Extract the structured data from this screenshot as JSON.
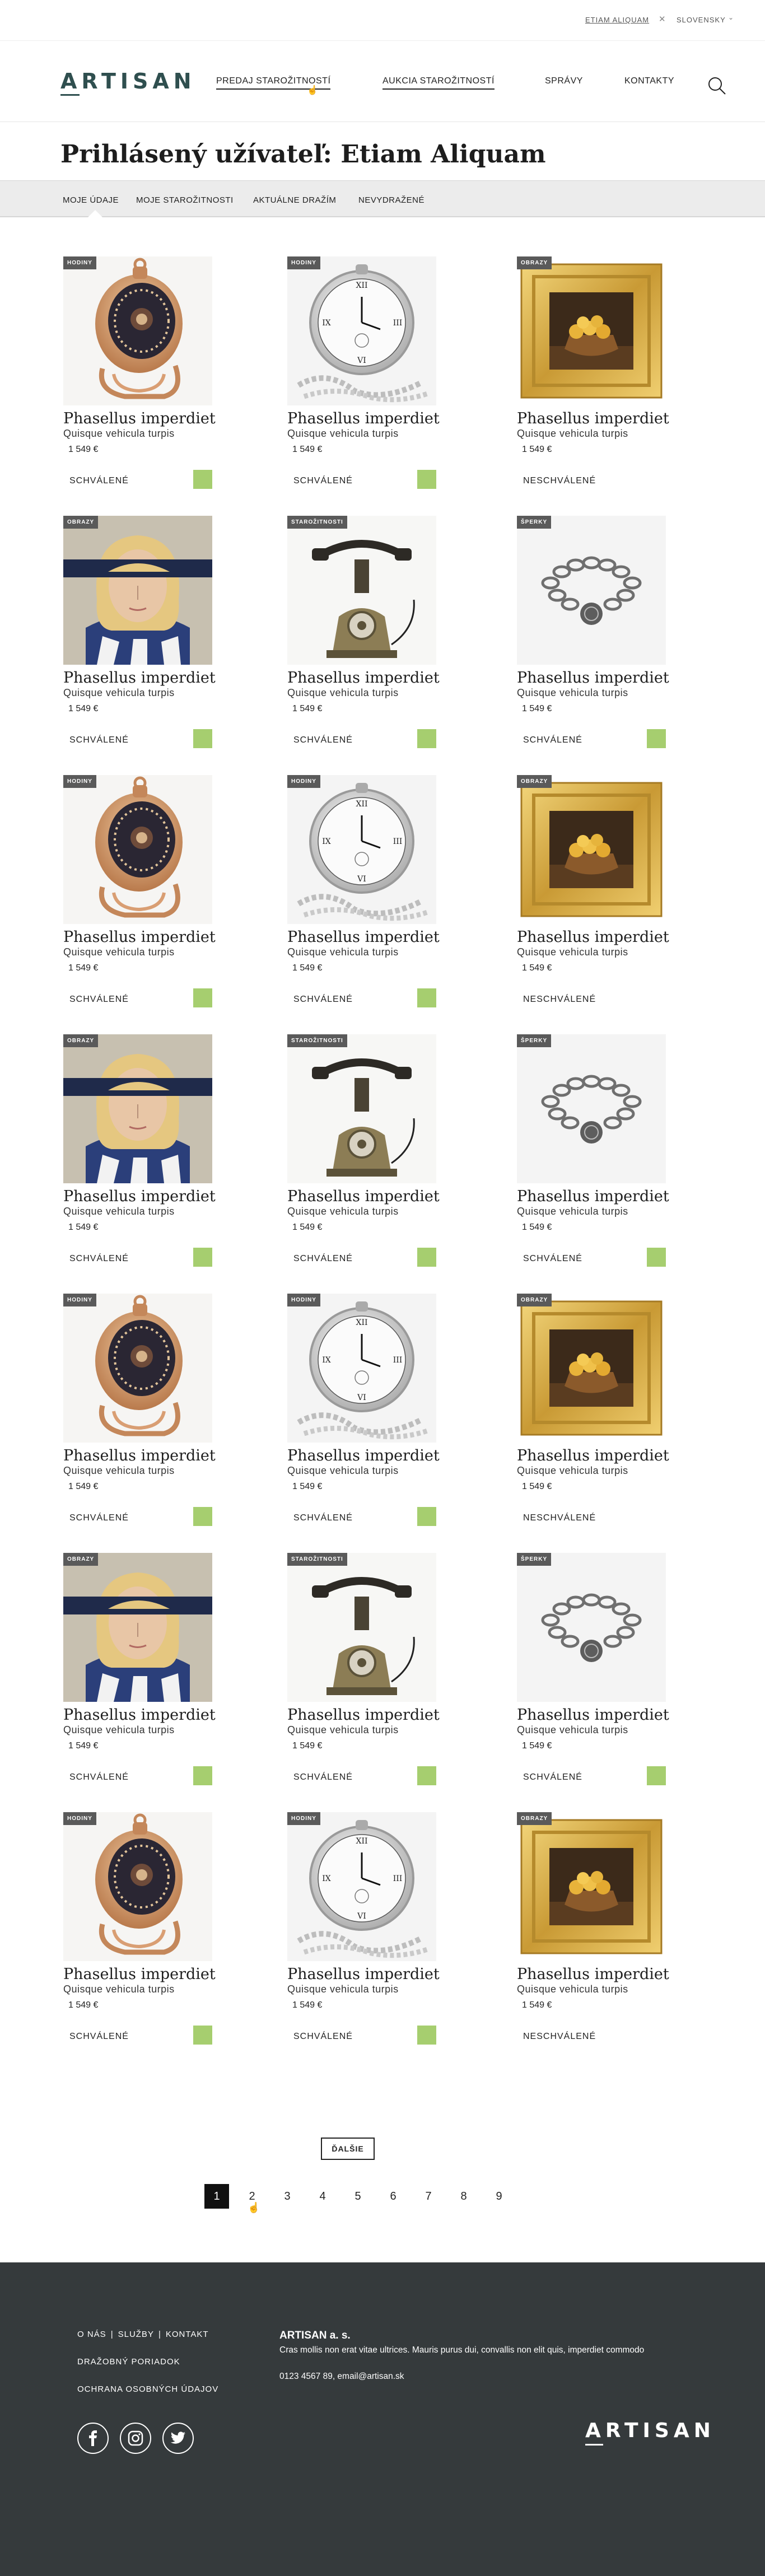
{
  "topbar": {
    "user": "ETIAM ALIQUAM",
    "language": "SLOVENSKY"
  },
  "header": {
    "logo": "ARTISAN",
    "nav": [
      "PREDAJ STAROŽITNOSTÍ",
      "AUKCIA STAROŽITNOSTÍ",
      "SPRÁVY",
      "KONTAKTY"
    ]
  },
  "page": {
    "title": "Prihlásený užívateľ: Etiam Aliquam"
  },
  "tabs": [
    "MOJE ÚDAJE",
    "MOJE STAROŽITNOSTI",
    "AKTUÁLNE DRAŽÍM",
    "NEVYDRAŽENÉ"
  ],
  "items": [
    {
      "category": "HODINY",
      "name": "Phasellus imperdiet",
      "desc": "Quisque vehicula turpis",
      "price": "1 549 €",
      "status": "SCHVÁLENÉ",
      "approved": true,
      "image": "pocket-watch-gold"
    },
    {
      "category": "HODINY",
      "name": "Phasellus imperdiet",
      "desc": "Quisque vehicula turpis",
      "price": "1 549 €",
      "status": "SCHVÁLENÉ",
      "approved": true,
      "image": "pocket-watch-silver"
    },
    {
      "category": "OBRAZY",
      "name": "Phasellus imperdiet",
      "desc": "Quisque vehicula turpis",
      "price": "1 549 €",
      "status": "NESCHVÁLENÉ",
      "approved": false,
      "image": "framed-painting"
    },
    {
      "category": "OBRAZY",
      "name": "Phasellus imperdiet",
      "desc": "Quisque vehicula turpis",
      "price": "1 549 €",
      "status": "SCHVÁLENÉ",
      "approved": true,
      "image": "portrait-painting"
    },
    {
      "category": "STAROŽITNOSTI",
      "name": "Phasellus imperdiet",
      "desc": "Quisque vehicula turpis",
      "price": "1 549 €",
      "status": "SCHVÁLENÉ",
      "approved": true,
      "image": "antique-phone"
    },
    {
      "category": "ŠPERKY",
      "name": "Phasellus imperdiet",
      "desc": "Quisque vehicula turpis",
      "price": "1 549 €",
      "status": "SCHVÁLENÉ",
      "approved": true,
      "image": "silver-bracelet"
    },
    {
      "category": "HODINY",
      "name": "Phasellus imperdiet",
      "desc": "Quisque vehicula turpis",
      "price": "1 549 €",
      "status": "SCHVÁLENÉ",
      "approved": true,
      "image": "pocket-watch-gold"
    },
    {
      "category": "HODINY",
      "name": "Phasellus imperdiet",
      "desc": "Quisque vehicula turpis",
      "price": "1 549 €",
      "status": "SCHVÁLENÉ",
      "approved": true,
      "image": "pocket-watch-silver"
    },
    {
      "category": "OBRAZY",
      "name": "Phasellus imperdiet",
      "desc": "Quisque vehicula turpis",
      "price": "1 549 €",
      "status": "NESCHVÁLENÉ",
      "approved": false,
      "image": "framed-painting"
    },
    {
      "category": "OBRAZY",
      "name": "Phasellus imperdiet",
      "desc": "Quisque vehicula turpis",
      "price": "1 549 €",
      "status": "SCHVÁLENÉ",
      "approved": true,
      "image": "portrait-painting"
    },
    {
      "category": "STAROŽITNOSTI",
      "name": "Phasellus imperdiet",
      "desc": "Quisque vehicula turpis",
      "price": "1 549 €",
      "status": "SCHVÁLENÉ",
      "approved": true,
      "image": "antique-phone"
    },
    {
      "category": "ŠPERKY",
      "name": "Phasellus imperdiet",
      "desc": "Quisque vehicula turpis",
      "price": "1 549 €",
      "status": "SCHVÁLENÉ",
      "approved": true,
      "image": "silver-bracelet"
    },
    {
      "category": "HODINY",
      "name": "Phasellus imperdiet",
      "desc": "Quisque vehicula turpis",
      "price": "1 549 €",
      "status": "SCHVÁLENÉ",
      "approved": true,
      "image": "pocket-watch-gold"
    },
    {
      "category": "HODINY",
      "name": "Phasellus imperdiet",
      "desc": "Quisque vehicula turpis",
      "price": "1 549 €",
      "status": "SCHVÁLENÉ",
      "approved": true,
      "image": "pocket-watch-silver"
    },
    {
      "category": "OBRAZY",
      "name": "Phasellus imperdiet",
      "desc": "Quisque vehicula turpis",
      "price": "1 549 €",
      "status": "NESCHVÁLENÉ",
      "approved": false,
      "image": "framed-painting"
    },
    {
      "category": "OBRAZY",
      "name": "Phasellus imperdiet",
      "desc": "Quisque vehicula turpis",
      "price": "1 549 €",
      "status": "SCHVÁLENÉ",
      "approved": true,
      "image": "portrait-painting"
    },
    {
      "category": "STAROŽITNOSTI",
      "name": "Phasellus imperdiet",
      "desc": "Quisque vehicula turpis",
      "price": "1 549 €",
      "status": "SCHVÁLENÉ",
      "approved": true,
      "image": "antique-phone"
    },
    {
      "category": "ŠPERKY",
      "name": "Phasellus imperdiet",
      "desc": "Quisque vehicula turpis",
      "price": "1 549 €",
      "status": "SCHVÁLENÉ",
      "approved": true,
      "image": "silver-bracelet"
    },
    {
      "category": "HODINY",
      "name": "Phasellus imperdiet",
      "desc": "Quisque vehicula turpis",
      "price": "1 549 €",
      "status": "SCHVÁLENÉ",
      "approved": true,
      "image": "pocket-watch-gold"
    },
    {
      "category": "HODINY",
      "name": "Phasellus imperdiet",
      "desc": "Quisque vehicula turpis",
      "price": "1 549 €",
      "status": "SCHVÁLENÉ",
      "approved": true,
      "image": "pocket-watch-silver"
    },
    {
      "category": "OBRAZY",
      "name": "Phasellus imperdiet",
      "desc": "Quisque vehicula turpis",
      "price": "1 549 €",
      "status": "NESCHVÁLENÉ",
      "approved": false,
      "image": "framed-painting"
    }
  ],
  "pagination": {
    "next_label": "ĎALŠIE",
    "pages": [
      "1",
      "2",
      "3",
      "4",
      "5",
      "6",
      "7",
      "8",
      "9"
    ],
    "current": "1"
  },
  "footer": {
    "links_row1": [
      "O NÁS",
      "SLUŽBY",
      "KONTAKT"
    ],
    "link_order": "DRAŽOBNÝ PORIADOK",
    "link_privacy": "OCHRANA OSOBNÝCH ÚDAJOV",
    "company": "ARTISAN a. s.",
    "text": "Cras mollis non erat vitae ultrices. Mauris purus dui, convallis non elit quis, imperdiet commodo",
    "contact": "0123 4567 89, email@artisan.sk",
    "logo": "ARTISAN",
    "social": [
      "facebook-icon",
      "instagram-icon",
      "twitter-icon"
    ]
  },
  "colors": {
    "brand": "#2f4f4f",
    "approved": "#a6ce6f",
    "footer_bg": "#353a3c"
  }
}
